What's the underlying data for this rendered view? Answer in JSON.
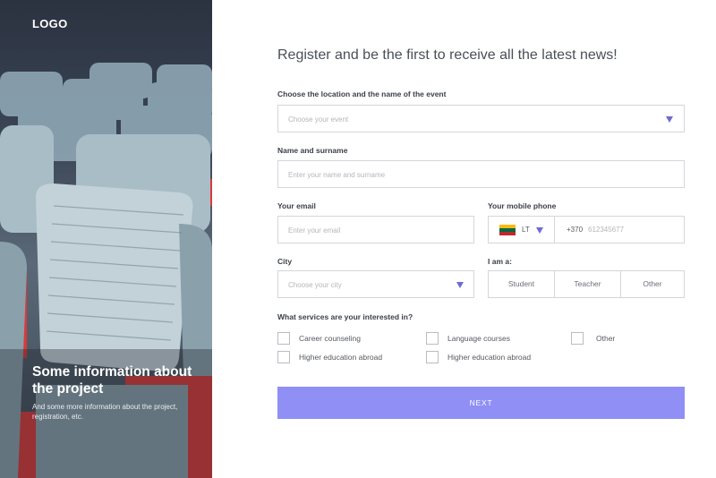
{
  "sidebar": {
    "logo": "LOGO",
    "project_title": "Some information about the project",
    "project_subtitle": "And some more information about the project, registration, etc."
  },
  "form": {
    "heading": "Register and be the first to receive all the latest news!",
    "event": {
      "label": "Choose the location and the name of the event",
      "placeholder": "Choose your event"
    },
    "name": {
      "label": "Name and surname",
      "placeholder": "Enter your name and surname"
    },
    "email": {
      "label": "Your email",
      "placeholder": "Enter your email"
    },
    "phone": {
      "label": "Your mobile phone",
      "country_code": "LT",
      "prefix": "+370",
      "placeholder": "612345677"
    },
    "city": {
      "label": "City",
      "placeholder": "Choose your city"
    },
    "role": {
      "label": "I am a:",
      "options": [
        "Student",
        "Teacher",
        "Other"
      ]
    },
    "services": {
      "label": "What services are your interested in?",
      "options": [
        "Career counseling",
        "Language courses",
        "Other",
        "Higher education abroad",
        "Higher education abroad"
      ]
    },
    "next_label": "NEXT"
  },
  "colors": {
    "accent": "#8f8ff5",
    "arrow": "#6f69d6"
  }
}
